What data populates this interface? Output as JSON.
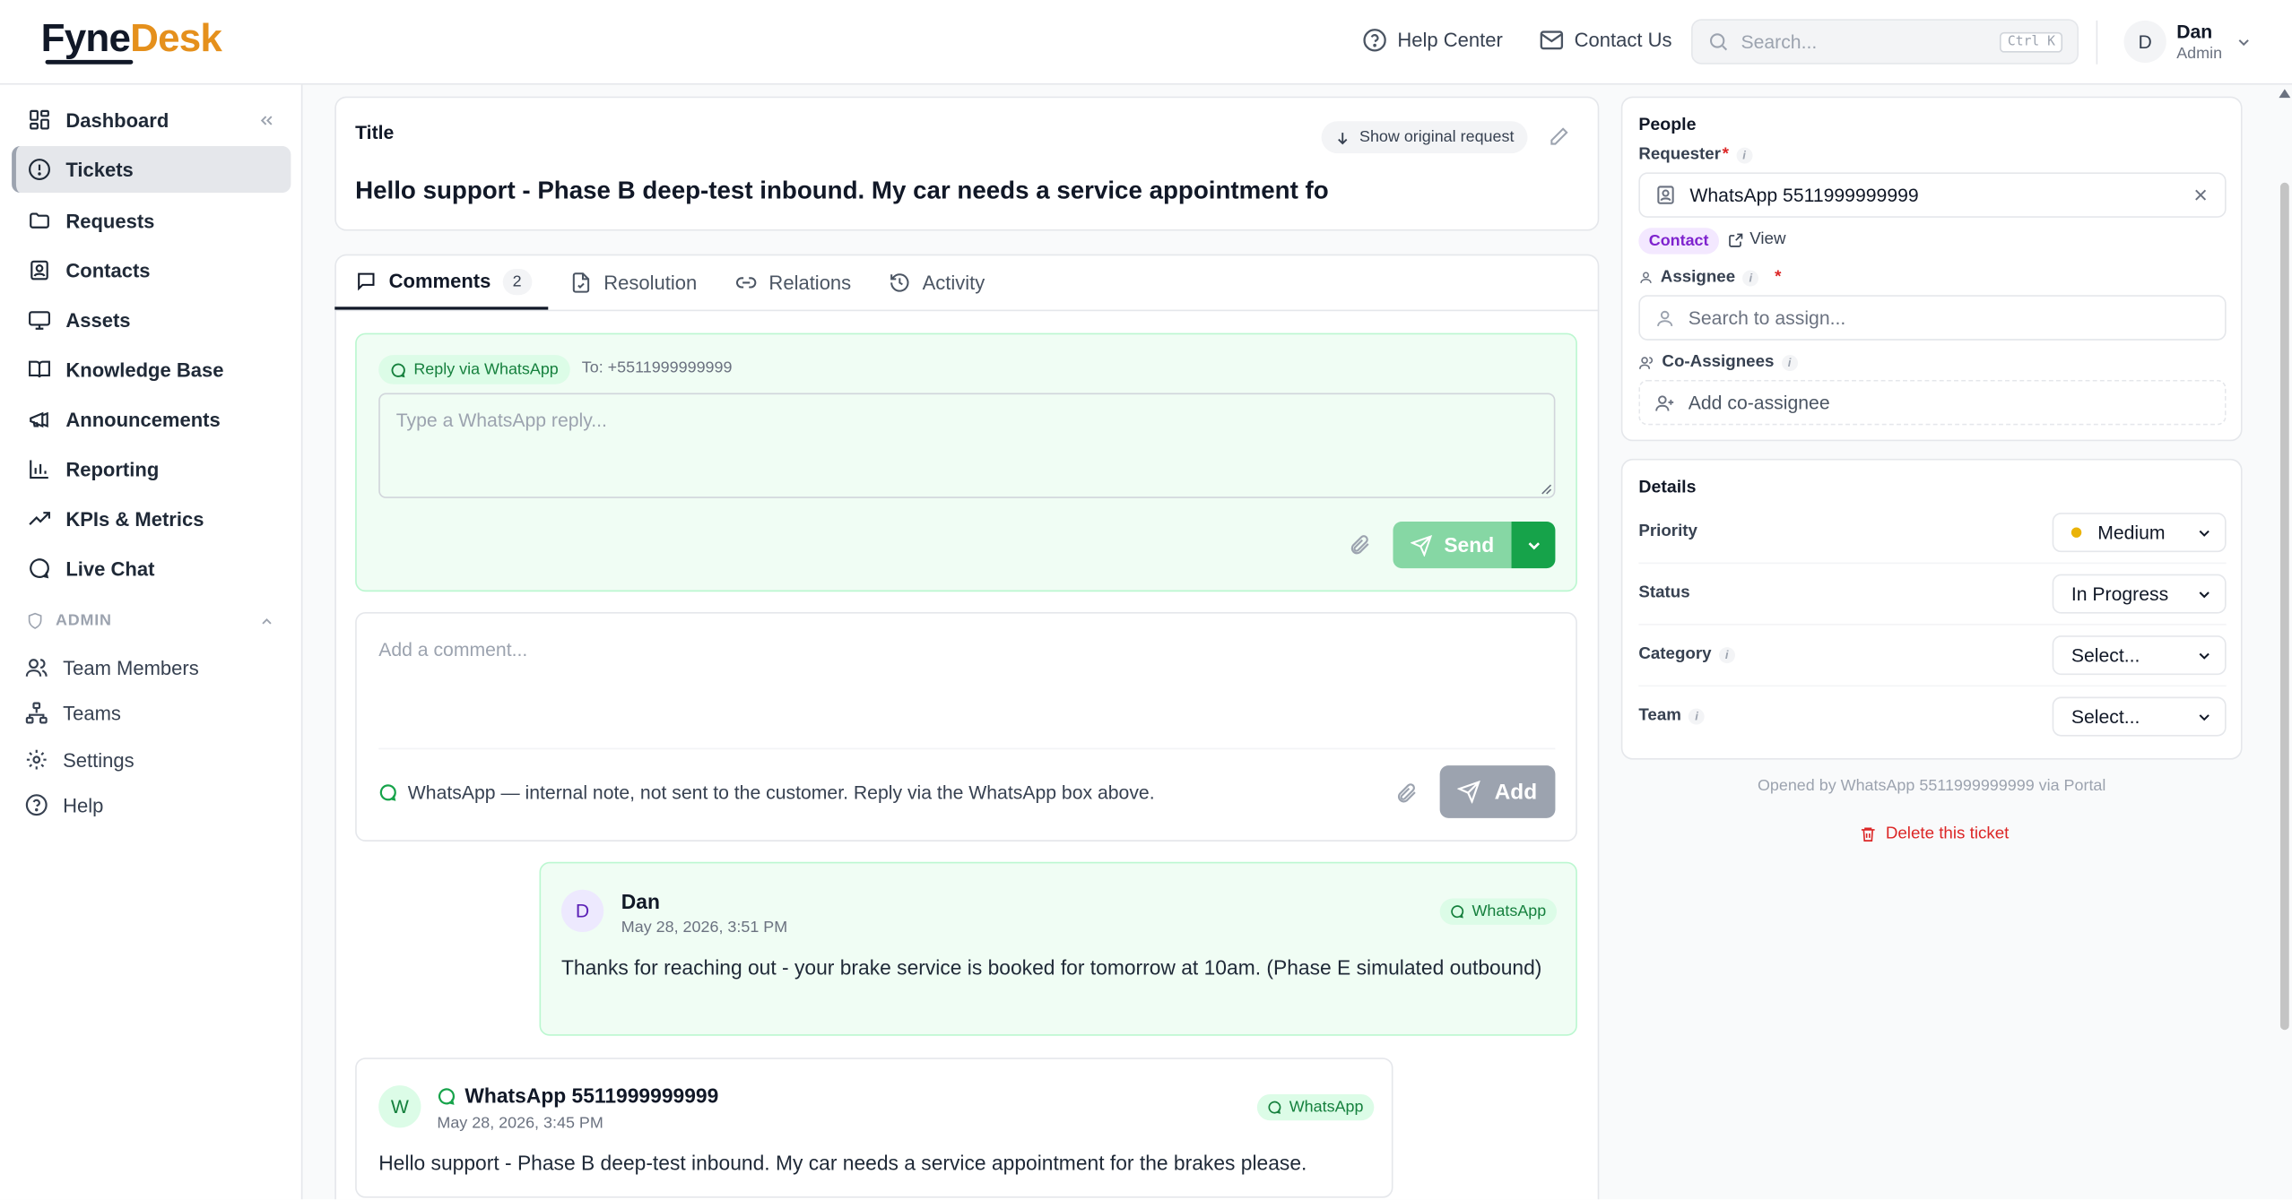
{
  "app": {
    "logo_part1": "Fyne",
    "logo_part2": "Desk"
  },
  "header": {
    "help_center": "Help Center",
    "contact_us": "Contact Us",
    "search_placeholder": "Search...",
    "search_shortcut": "Ctrl K",
    "user_initial": "D",
    "user_name": "Dan",
    "user_role": "Admin"
  },
  "sidebar": {
    "items": [
      {
        "label": "Dashboard",
        "icon": "dashboard-icon"
      },
      {
        "label": "Tickets",
        "icon": "alert-circle-icon",
        "active": true
      },
      {
        "label": "Requests",
        "icon": "folder-icon"
      },
      {
        "label": "Contacts",
        "icon": "contact-card-icon"
      },
      {
        "label": "Assets",
        "icon": "monitor-icon"
      },
      {
        "label": "Knowledge Base",
        "icon": "book-icon"
      },
      {
        "label": "Announcements",
        "icon": "megaphone-icon"
      },
      {
        "label": "Reporting",
        "icon": "bar-chart-icon"
      },
      {
        "label": "KPIs & Metrics",
        "icon": "trending-up-icon"
      },
      {
        "label": "Live Chat",
        "icon": "chat-bubble-icon"
      }
    ],
    "admin_label": "ADMIN",
    "admin_items": [
      {
        "label": "Team Members",
        "icon": "users-icon"
      },
      {
        "label": "Teams",
        "icon": "hierarchy-icon"
      },
      {
        "label": "Settings",
        "icon": "gear-icon"
      },
      {
        "label": "Help",
        "icon": "help-circle-icon"
      }
    ]
  },
  "ticket": {
    "title_label": "Title",
    "show_original": "Show original request",
    "title": "Hello support - Phase B deep-test inbound. My car needs a service appointment fo"
  },
  "tabs": [
    {
      "label": "Comments",
      "count": "2",
      "active": true
    },
    {
      "label": "Resolution"
    },
    {
      "label": "Relations"
    },
    {
      "label": "Activity"
    }
  ],
  "reply": {
    "channel_label": "Reply via WhatsApp",
    "to": "To: +5511999999999",
    "placeholder": "Type a WhatsApp reply...",
    "send_label": "Send"
  },
  "comment": {
    "placeholder": "Add a comment...",
    "note": "WhatsApp — internal note, not sent to the customer. Reply via the WhatsApp box above.",
    "add_label": "Add"
  },
  "messages": [
    {
      "initial": "D",
      "author": "Dan",
      "date": "May 28, 2026, 3:51 PM",
      "channel": "WhatsApp",
      "body": "Thanks for reaching out - your brake service is booked for tomorrow at 10am. (Phase E simulated outbound)"
    },
    {
      "initial": "W",
      "author": "WhatsApp 5511999999999",
      "date": "May 28, 2026, 3:45 PM",
      "channel": "WhatsApp",
      "body": "Hello support - Phase B deep-test inbound. My car needs a service appointment for the brakes please."
    }
  ],
  "people": {
    "title": "People",
    "requester_label": "Requester",
    "requester_value": "WhatsApp 5511999999999",
    "contact_tag": "Contact",
    "view_label": "View",
    "assignee_label": "Assignee",
    "assignee_placeholder": "Search to assign...",
    "co_assignees_label": "Co-Assignees",
    "co_assignee_placeholder": "Add co-assignee"
  },
  "details": {
    "title": "Details",
    "priority_label": "Priority",
    "priority_value": "Medium",
    "status_label": "Status",
    "status_value": "In Progress",
    "category_label": "Category",
    "category_value": "Select...",
    "team_label": "Team",
    "team_value": "Select..."
  },
  "footer": {
    "opened_by": "Opened by WhatsApp 5511999999999 via Portal",
    "delete_label": "Delete this ticket"
  },
  "colors": {
    "brand_orange": "#e5901c",
    "whatsapp_green": "#16a34a",
    "priority_medium": "#eab308",
    "danger": "#dc2626"
  }
}
